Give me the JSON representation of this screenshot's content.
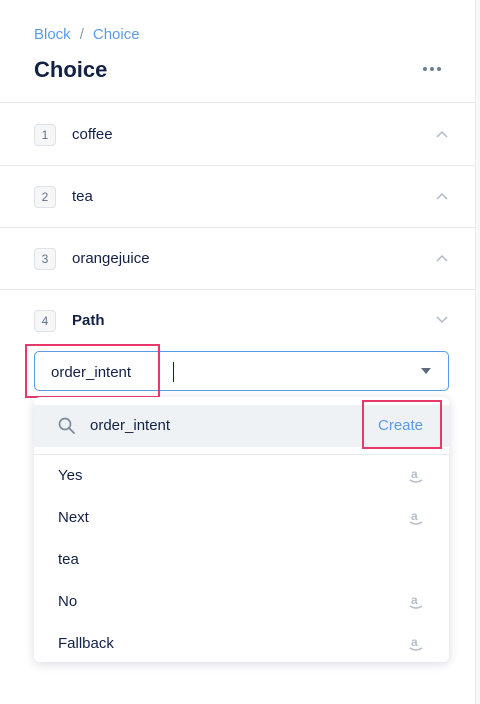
{
  "breadcrumb": {
    "parent": "Block",
    "separator": "/",
    "current": "Choice"
  },
  "title": "Choice",
  "choices": [
    {
      "number": "1",
      "label": "coffee",
      "state": "collapsed"
    },
    {
      "number": "2",
      "label": "tea",
      "state": "collapsed"
    },
    {
      "number": "3",
      "label": "orangejuice",
      "state": "collapsed"
    },
    {
      "number": "4",
      "label": "Path",
      "state": "expanded"
    }
  ],
  "intent_select": {
    "value": "order_intent"
  },
  "dropdown": {
    "search_value": "order_intent",
    "create_label": "Create",
    "options": [
      {
        "label": "Yes",
        "icon": "amazon-icon"
      },
      {
        "label": "Next",
        "icon": "amazon-icon"
      },
      {
        "label": "tea",
        "icon": ""
      },
      {
        "label": "No",
        "icon": "amazon-icon"
      },
      {
        "label": "Fallback",
        "icon": "amazon-icon"
      }
    ]
  },
  "colors": {
    "accent": "#5b9be6",
    "highlight": "#e9396b",
    "text": "#132144"
  }
}
